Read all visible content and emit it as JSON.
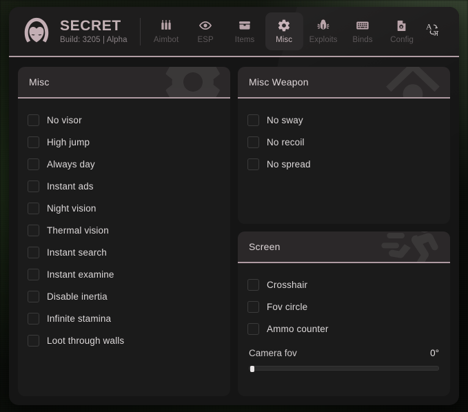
{
  "app": {
    "brand_name": "SECRET",
    "build_text": "Build: 3205 | Alpha",
    "logo_icon": "hooded-figure-logo"
  },
  "nav": {
    "tabs": [
      {
        "label": "Aimbot",
        "icon": "bullets-icon",
        "active": false
      },
      {
        "label": "ESP",
        "icon": "eye-icon",
        "active": false
      },
      {
        "label": "Items",
        "icon": "briefcase-icon",
        "active": false
      },
      {
        "label": "Misc",
        "icon": "gear-icon",
        "active": true
      },
      {
        "label": "Exploits",
        "icon": "bug-icon",
        "active": false
      },
      {
        "label": "Binds",
        "icon": "keyboard-icon",
        "active": false
      },
      {
        "label": "Config",
        "icon": "file-gear-icon",
        "active": false
      }
    ],
    "language_icon": "translate-language-icon"
  },
  "panels": {
    "misc": {
      "title": "Misc",
      "watermark_icon": "gear-watermark-icon",
      "checkboxes": [
        {
          "label": "No visor",
          "checked": false
        },
        {
          "label": "High jump",
          "checked": false
        },
        {
          "label": "Always day",
          "checked": false
        },
        {
          "label": "Instant ads",
          "checked": false
        },
        {
          "label": "Night vision",
          "checked": false
        },
        {
          "label": "Thermal vision",
          "checked": false
        },
        {
          "label": "Instant search",
          "checked": false
        },
        {
          "label": "Instant examine",
          "checked": false
        },
        {
          "label": "Disable inertia",
          "checked": false
        },
        {
          "label": "Infinite stamina",
          "checked": false
        },
        {
          "label": "Loot through walls",
          "checked": false
        }
      ]
    },
    "misc_weapon": {
      "title": "Misc Weapon",
      "watermark_icon": "scope-crosshair-watermark-icon",
      "checkboxes": [
        {
          "label": "No sway",
          "checked": false
        },
        {
          "label": "No recoil",
          "checked": false
        },
        {
          "label": "No spread",
          "checked": false
        }
      ]
    },
    "screen": {
      "title": "Screen",
      "watermark_icon": "running-person-watermark-icon",
      "checkboxes": [
        {
          "label": "Crosshair",
          "checked": false
        },
        {
          "label": "Fov circle",
          "checked": false
        },
        {
          "label": "Ammo counter",
          "checked": false
        }
      ],
      "slider": {
        "label": "Camera fov",
        "value_text": "0°",
        "value": 0,
        "min": 0,
        "max": 100
      }
    }
  },
  "colors": {
    "accent": "#d4bcc4",
    "panel_bg": "#1b1b1b",
    "panel_head_bg": "#2b2829",
    "window_bg": "#151515",
    "header_bg": "#1e1d1d",
    "text": "#dcd8d9",
    "text_muted": "#5c5759"
  }
}
